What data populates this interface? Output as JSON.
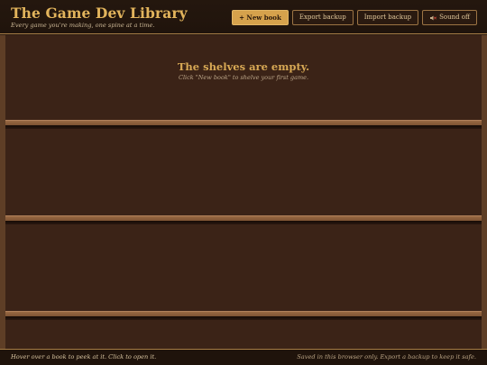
{
  "header": {
    "title": "The Game Dev Library",
    "tagline": "Every game you're making, one spine at a time."
  },
  "toolbar": {
    "new_book_label": "+ New book",
    "export_label": "Export backup",
    "import_label": "Import backup",
    "sound_label": "Sound off",
    "sound_icon": "speaker-muted-icon"
  },
  "library": {
    "empty_title": "The shelves are empty.",
    "empty_hint": "Click \"New book\" to shelve your first game."
  },
  "footer": {
    "hint": "Hover over a book to peek at it. Click to open it.",
    "storage_note": "Saved in this browser only. Export a backup to keep it safe."
  },
  "colors": {
    "accent": "#d6a24c",
    "title": "#e2b45c",
    "wood": "#8a5d3b",
    "background": "#3b2317"
  }
}
